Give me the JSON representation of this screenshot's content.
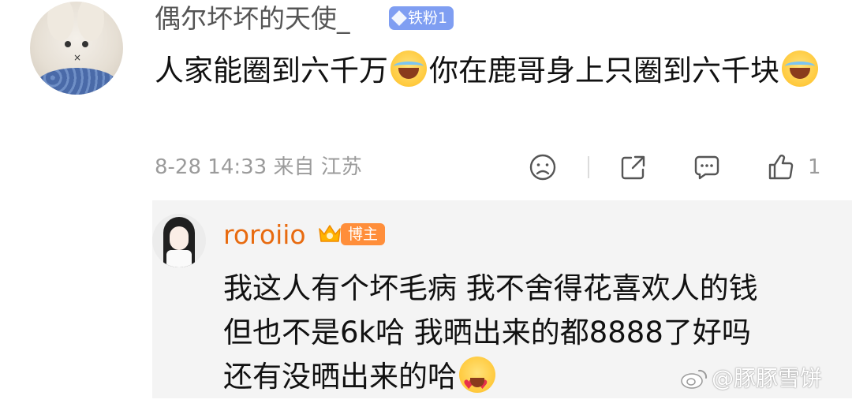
{
  "comment": {
    "username": "偶尔坏坏的天使_",
    "badge": "铁粉1",
    "text_part1": "人家能圈到六千万",
    "text_part2": "你在鹿哥身上只圈到六千块",
    "meta": "8-28 14:33 来自 江苏",
    "like_count": "1",
    "icons": [
      "dislike-icon",
      "share-icon",
      "comment-icon",
      "like-icon"
    ]
  },
  "reply": {
    "username": "roroiio",
    "badge": "博主",
    "line1": "我这人有个坏毛病 我不舍得花喜欢人的钱",
    "line2": "但也不是6k哈 我晒出来的都8888了好吗",
    "line3": "还有没晒出来的哈"
  },
  "watermark": "@豚豚雪饼",
  "colors": {
    "fan_badge": "#7f9ef2",
    "author_badge": "#ff8e3a",
    "reply_name": "#e86b10",
    "reply_bg": "#f4f4f4"
  }
}
